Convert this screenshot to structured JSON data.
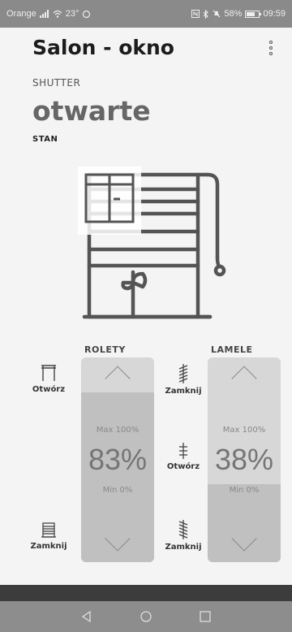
{
  "status_bar": {
    "carrier": "Orange",
    "temp": "23°",
    "battery": "58%",
    "time": "09:59"
  },
  "header": {
    "title": "Salon - okno"
  },
  "device": {
    "type": "SHUTTER",
    "state_value": "otwarte",
    "state_label": "STAN"
  },
  "rolety": {
    "header": "ROLETY",
    "open_label": "Otwórz",
    "close_label": "Zamknij",
    "max_label": "Max 100%",
    "min_label": "Min 0%",
    "percent": "83%",
    "level": 0.83
  },
  "lamele": {
    "header": "LAMELE",
    "close_top_label": "Zamknij",
    "open_mid_label": "Otwórz",
    "close_bottom_label": "Zamknij",
    "max_label": "Max 100%",
    "min_label": "Min 0%",
    "percent": "38%",
    "level": 0.38
  },
  "icons": {
    "signal": "signal-icon",
    "wifi": "wifi-icon",
    "nfc": "nfc-icon",
    "bluetooth": "bluetooth-icon",
    "battery": "battery-icon",
    "menu": "more-vertical-icon",
    "back": "nav-back-icon",
    "home": "nav-home-icon",
    "recents": "nav-recents-icon"
  }
}
